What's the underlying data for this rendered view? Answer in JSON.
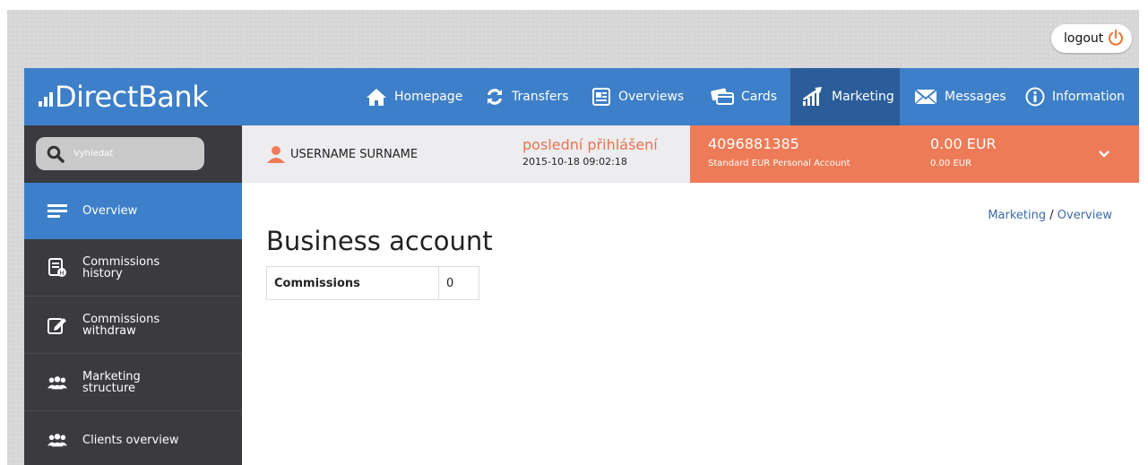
{
  "topbar": {
    "logout_label": "logout"
  },
  "brand": {
    "logo_text": "DirectBank"
  },
  "nav": {
    "items": [
      {
        "label": "Homepage",
        "icon": "home-icon"
      },
      {
        "label": "Transfers",
        "icon": "transfer-icon"
      },
      {
        "label": "Overviews",
        "icon": "overview-icon"
      },
      {
        "label": "Cards",
        "icon": "cards-icon"
      },
      {
        "label": "Marketing",
        "icon": "chart-icon",
        "active": true
      },
      {
        "label": "Messages",
        "icon": "mail-icon"
      },
      {
        "label": "Information",
        "icon": "info-icon"
      }
    ]
  },
  "sidebar": {
    "search_placeholder": "Vyhledat",
    "items": [
      {
        "label": "Overview",
        "icon": "list-icon",
        "active": true
      },
      {
        "label": "Commissions\nhistory",
        "icon": "history-icon"
      },
      {
        "label": "Commissions\nwithdraw",
        "icon": "edit-icon"
      },
      {
        "label": "Marketing\nstructure",
        "icon": "group-icon"
      },
      {
        "label": "Clients overview",
        "icon": "group-icon"
      }
    ]
  },
  "user": {
    "name": "USERNAME SURNAME",
    "last_login_label": "poslední přihlášení",
    "last_login_time": "2015-10-18 09:02:18"
  },
  "account": {
    "number": "4096881385",
    "name": "Standard EUR Personal Account",
    "balance": "0.00 EUR",
    "available": "0.00 EUR"
  },
  "breadcrumb": {
    "parent": "Marketing",
    "separator": "/",
    "current": "Overview"
  },
  "page": {
    "title": "Business account",
    "table": {
      "label": "Commissions",
      "value": "0"
    }
  },
  "colors": {
    "nav_blue": "#3d7fc8",
    "nav_active": "#2a5d9a",
    "sidebar": "#3a3a3f",
    "accent_orange": "#ee7b57"
  }
}
